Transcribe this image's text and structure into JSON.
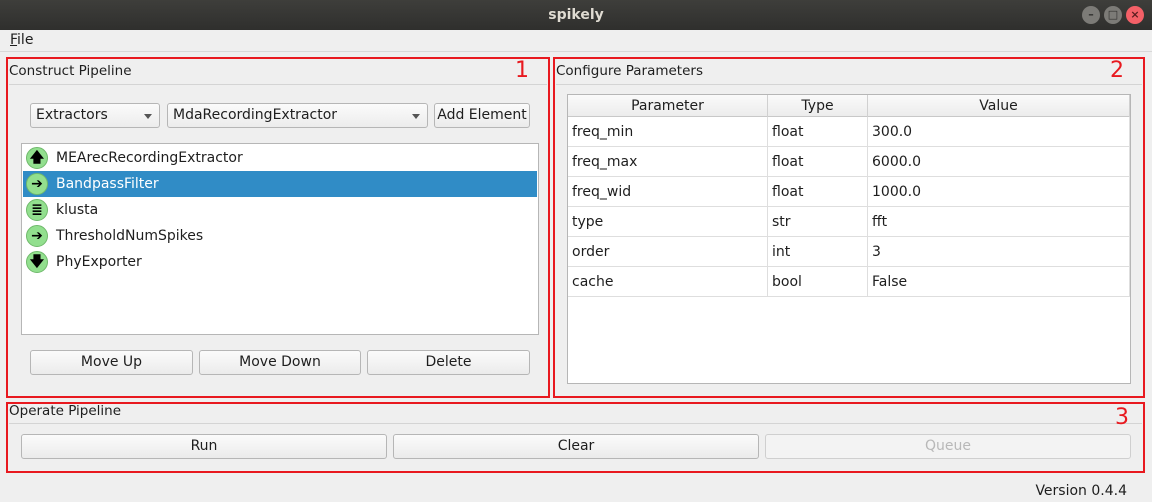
{
  "window": {
    "title": "spikely"
  },
  "menu": {
    "file": "File"
  },
  "construct": {
    "title": "Construct Pipeline",
    "annotation": "1",
    "category_combo": "Extractors",
    "element_combo": "MdaRecordingExtractor",
    "add_label": "Add Element",
    "items": [
      {
        "label": "MEArecRecordingExtractor",
        "icon": "up-arrow-icon",
        "glyph": "🡅",
        "selected": false
      },
      {
        "label": "BandpassFilter",
        "icon": "filter-icon",
        "glyph": "➔",
        "selected": true
      },
      {
        "label": "klusta",
        "icon": "sorter-icon",
        "glyph": "≣",
        "selected": false
      },
      {
        "label": "ThresholdNumSpikes",
        "icon": "curator-icon",
        "glyph": "➔",
        "selected": false
      },
      {
        "label": "PhyExporter",
        "icon": "down-arrow-icon",
        "glyph": "🡇",
        "selected": false
      }
    ],
    "move_up": "Move Up",
    "move_down": "Move Down",
    "delete": "Delete"
  },
  "configure": {
    "title": "Configure Parameters",
    "annotation": "2",
    "headers": [
      "Parameter",
      "Type",
      "Value"
    ],
    "rows": [
      [
        "freq_min",
        "float",
        "300.0"
      ],
      [
        "freq_max",
        "float",
        "6000.0"
      ],
      [
        "freq_wid",
        "float",
        "1000.0"
      ],
      [
        "type",
        "str",
        "fft"
      ],
      [
        "order",
        "int",
        "3"
      ],
      [
        "cache",
        "bool",
        "False"
      ]
    ]
  },
  "operate": {
    "title": "Operate Pipeline",
    "annotation": "3",
    "run": "Run",
    "clear": "Clear",
    "queue": "Queue"
  },
  "status": {
    "version": "Version 0.4.4"
  },
  "colors": {
    "annotation": "#e8191f",
    "selection": "#308cc6",
    "icon_bg": "#92df8e"
  }
}
